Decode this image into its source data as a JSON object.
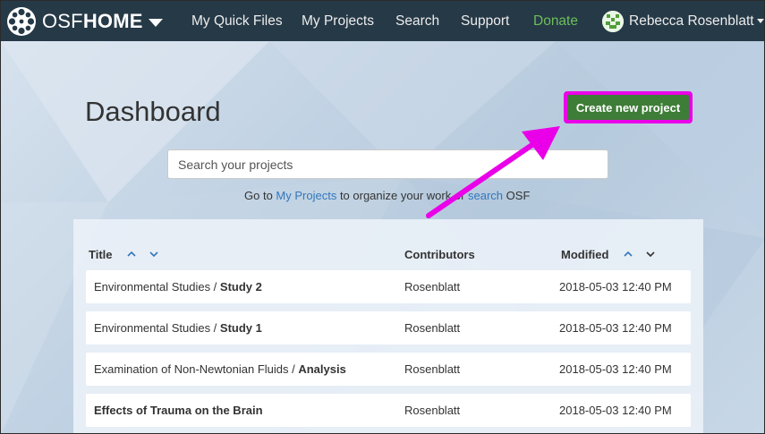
{
  "brand": {
    "light": "OSF",
    "bold": "HOME"
  },
  "nav": {
    "links": [
      "My Quick Files",
      "My Projects",
      "Search",
      "Support"
    ],
    "donate": "Donate",
    "user_name": "Rebecca Rosenblatt"
  },
  "dashboard": {
    "title": "Dashboard",
    "create_button": "Create new project",
    "search_placeholder": "Search your projects",
    "help": {
      "pre": "Go to ",
      "my_projects_link": "My Projects",
      "mid": " to organize your work or ",
      "search_link": "search",
      "post": " OSF"
    }
  },
  "table": {
    "headers": {
      "title": "Title",
      "contributors": "Contributors",
      "modified": "Modified"
    },
    "rows": [
      {
        "parent": "Environmental Studies / ",
        "name": "Study 2",
        "contributors": "Rosenblatt",
        "modified": "2018-05-03 12:40 PM"
      },
      {
        "parent": "Environmental Studies / ",
        "name": "Study 1",
        "contributors": "Rosenblatt",
        "modified": "2018-05-03 12:40 PM"
      },
      {
        "parent": "Examination of Non-Newtonian Fluids / ",
        "name": "Analysis",
        "contributors": "Rosenblatt",
        "modified": "2018-05-03 12:40 PM"
      },
      {
        "parent": "",
        "name": "Effects of Trauma on the Brain",
        "contributors": "Rosenblatt",
        "modified": "2018-05-03 12:40 PM"
      }
    ]
  },
  "icons": {
    "brand_logo": "osf-logo-icon",
    "avatar": "identicon-avatar-icon",
    "sort_asc": "chevron-up-icon",
    "sort_desc": "chevron-down-icon",
    "annotation": "magenta-arrow-icon"
  },
  "colors": {
    "navbar": "#263947",
    "donate": "#6cbf5a",
    "create_button": "#3e7d37",
    "highlight": "#ea00e8",
    "link": "#3377bb",
    "sort_icon": "#3377bb"
  }
}
